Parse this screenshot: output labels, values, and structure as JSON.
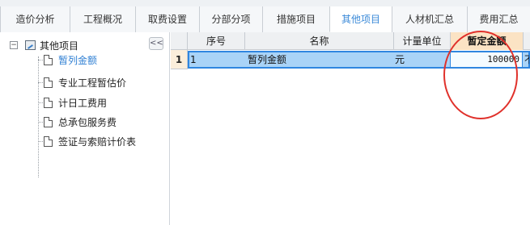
{
  "tabs": [
    {
      "label": "造价分析"
    },
    {
      "label": "工程概况"
    },
    {
      "label": "取费设置"
    },
    {
      "label": "分部分项"
    },
    {
      "label": "措施项目"
    },
    {
      "label": "其他项目",
      "active": true
    },
    {
      "label": "人材机汇总"
    },
    {
      "label": "费用汇总"
    }
  ],
  "tree": {
    "root_label": "其他项目",
    "expander": "−",
    "collapse_glyph": "<<",
    "items": [
      {
        "label": "暂列金额",
        "selected": true
      },
      {
        "label": "专业工程暂估价"
      },
      {
        "label": "计日工费用"
      },
      {
        "label": "总承包服务费"
      },
      {
        "label": "签证与索赔计价表"
      }
    ]
  },
  "grid": {
    "columns": [
      "序号",
      "名称",
      "计量单位",
      "暂定金额"
    ],
    "rows": [
      {
        "row_number": "1",
        "index": "1",
        "name": "暂列金额",
        "unit": "元",
        "amount": "100000",
        "extra": "不"
      }
    ]
  },
  "colors": {
    "accent": "#3b8ad8",
    "row_selected": "#a9d3f7",
    "header_highlight": "#fbe3c4",
    "annotation": "#e0312b"
  }
}
